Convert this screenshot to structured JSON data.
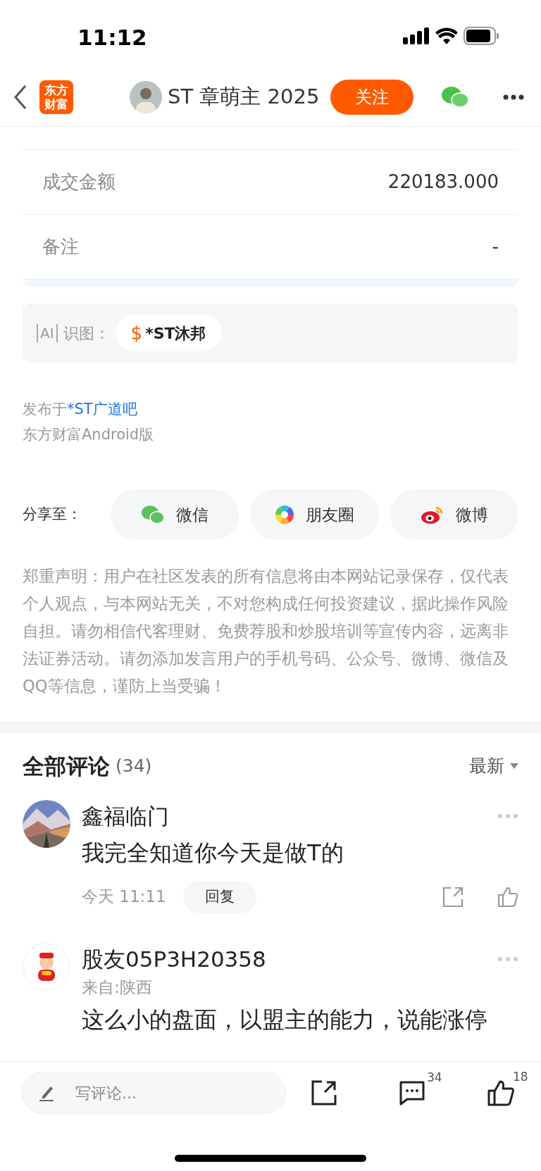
{
  "status_bar": {
    "time": "11:12"
  },
  "nav": {
    "logo_lines": [
      "东方",
      "财富"
    ],
    "author": "ST 章萌主 2025",
    "follow_button": "关注"
  },
  "details": [
    {
      "label": "成交金额",
      "value": "220183.000"
    },
    {
      "label": "备注",
      "value": "-"
    }
  ],
  "ai_recognition": {
    "badge": "AI",
    "label": "识图：",
    "symbol": "$",
    "stock": "*ST沐邦"
  },
  "post_info": {
    "prefix": "发布于",
    "forum_link": "*ST广道吧",
    "source": "东方财富Android版"
  },
  "share": {
    "label": "分享至：",
    "targets": [
      {
        "kind": "wechat",
        "label": "微信"
      },
      {
        "kind": "moments",
        "label": "朋友圈"
      },
      {
        "kind": "weibo",
        "label": "微博"
      }
    ]
  },
  "disclaimer": "郑重声明：用户在社区发表的所有信息将由本网站记录保存，仅代表个人观点，与本网站无关，不对您构成任何投资建议，据此操作风险自担。请勿相信代客理财、免费荐股和炒股培训等宣传内容，远离非法证券活动。请勿添加发言用户的手机号码、公众号、微博、微信及QQ等信息，谨防上当受骗！",
  "comments_header": {
    "title": "全部评论",
    "count": "(34)",
    "sort": "最新"
  },
  "comments": [
    {
      "author": "鑫福临门",
      "text": "我完全知道你今天是做T的",
      "time": "今天 11:11",
      "reply": "回复"
    },
    {
      "kind": "figure",
      "author": "股友05P3H20358",
      "location": "来自:陕西",
      "text": "这么小的盘面，以盟主的能力，说能涨停"
    }
  ],
  "bottom_bar": {
    "placeholder": "写评论...",
    "comment_count": "34",
    "like_count": "18"
  }
}
